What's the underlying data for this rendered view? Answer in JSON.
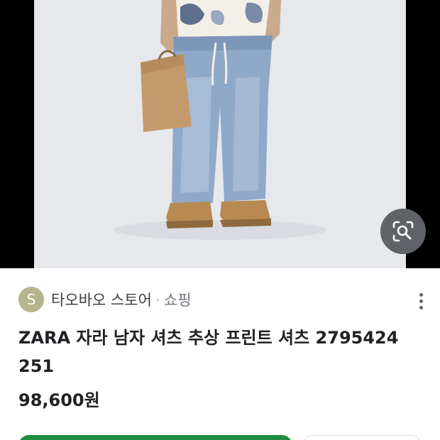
{
  "product_image": {
    "alt": "",
    "lens_icon": "image-search-lens-icon"
  },
  "result": {
    "source": {
      "avatar_letter": "S",
      "name": "타오바오 스토어",
      "separator": "·",
      "category": "쇼핑"
    },
    "title": "ZARA 자라 남자 셔츠 추상 프린트 셔츠 2795424 251",
    "price": "98,600원",
    "more_icon": "more-vert-icon"
  },
  "colors": {
    "frame": "#000000",
    "photo_background": "#e6e8ec",
    "lens_button": "#5f6368",
    "avatar": "#b5b48c",
    "primary_button": "#1e8e3e",
    "text_primary": "#202124",
    "text_secondary": "#70757a"
  }
}
